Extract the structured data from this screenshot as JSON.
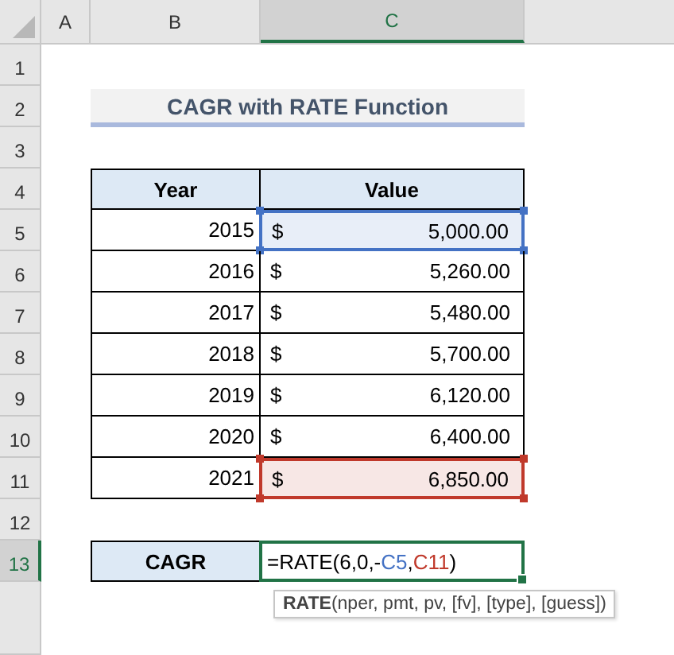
{
  "column_headers": [
    {
      "label": "A",
      "selected": false
    },
    {
      "label": "B",
      "selected": false
    },
    {
      "label": "C",
      "selected": true
    }
  ],
  "row_headers": [
    {
      "label": "1",
      "selected": false
    },
    {
      "label": "2",
      "selected": false
    },
    {
      "label": "3",
      "selected": false
    },
    {
      "label": "4",
      "selected": false
    },
    {
      "label": "5",
      "selected": false
    },
    {
      "label": "6",
      "selected": false
    },
    {
      "label": "7",
      "selected": false
    },
    {
      "label": "8",
      "selected": false
    },
    {
      "label": "9",
      "selected": false
    },
    {
      "label": "10",
      "selected": false
    },
    {
      "label": "11",
      "selected": false
    },
    {
      "label": "12",
      "selected": false
    },
    {
      "label": "13",
      "selected": true
    }
  ],
  "title": "CAGR with RATE Function",
  "table": {
    "columns": [
      "Year",
      "Value"
    ],
    "rows": [
      {
        "year": "2015",
        "currency": "$",
        "value": "5,000.00",
        "color": "#4472c4"
      },
      {
        "year": "2016",
        "currency": "$",
        "value": "5,260.00"
      },
      {
        "year": "2017",
        "currency": "$",
        "value": "5,480.00"
      },
      {
        "year": "2018",
        "currency": "$",
        "value": "5,700.00"
      },
      {
        "year": "2019",
        "currency": "$",
        "value": "6,120.00"
      },
      {
        "year": "2020",
        "currency": "$",
        "value": "6,400.00"
      },
      {
        "year": "2021",
        "currency": "$",
        "value": "6,850.00",
        "color": "#c0392b"
      }
    ]
  },
  "cagr": {
    "label": "CAGR",
    "active": true,
    "formula": {
      "prefix": "=RATE(6,0,-",
      "separator": ",",
      "suffix": ")",
      "references": [
        {
          "text": "C5",
          "color": "#4472c4"
        },
        {
          "text": "C11",
          "color": "#c0392b"
        }
      ]
    }
  },
  "tooltip": "**RATE**(nper, pmt, pv, [fv], [type], [guess])"
}
